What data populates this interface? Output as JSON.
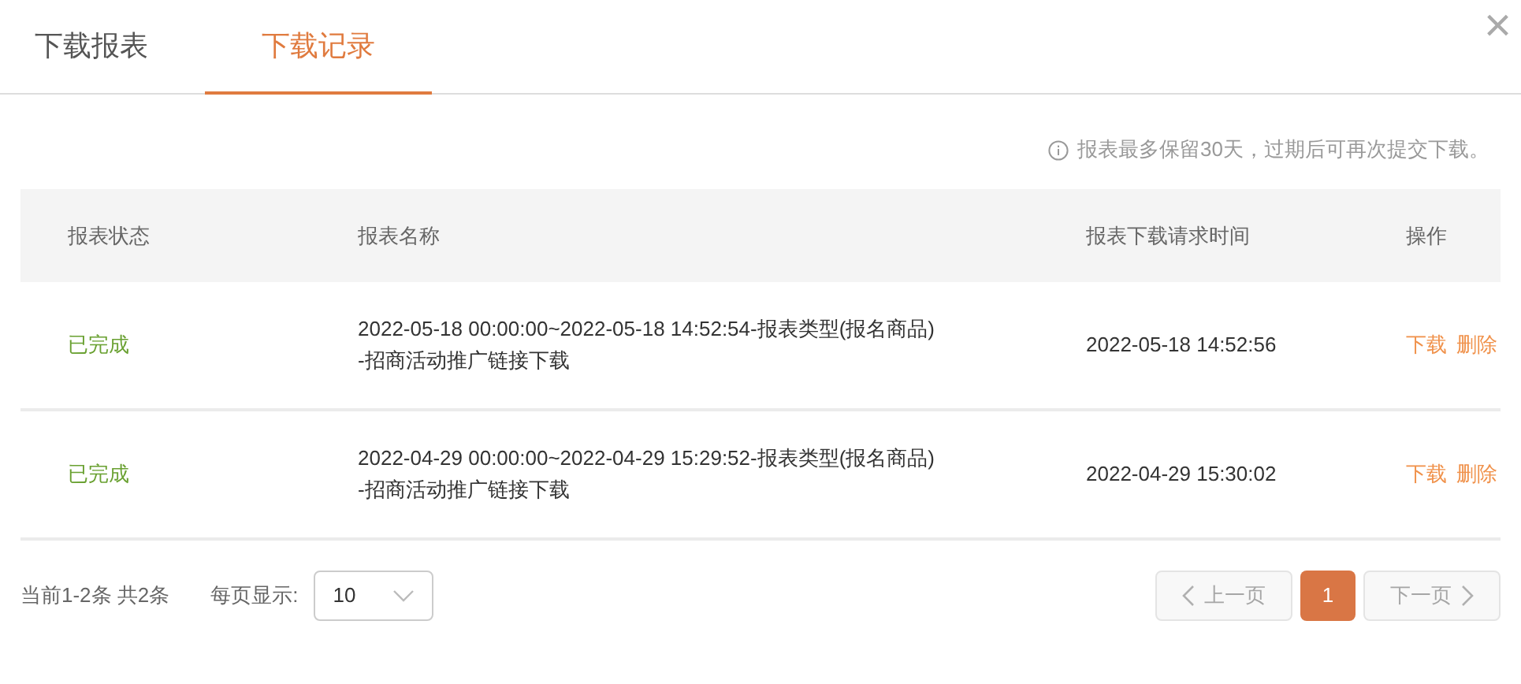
{
  "tabs": [
    {
      "label": "下载报表",
      "selected": false
    },
    {
      "label": "下载记录",
      "selected": true
    }
  ],
  "close": "×",
  "notice": "报表最多保留30天，过期后可再次提交下载。",
  "table": {
    "columns": [
      "报表状态",
      "报表名称",
      "报表下载请求时间",
      "操作"
    ],
    "rows": [
      {
        "status": "已完成",
        "name": [
          "2022-05-18 00:00:00~2022-05-18 14:52:54-报表类型(报名商品)",
          "-招商活动推广链接下载"
        ],
        "time": "2022-05-18 14:52:56",
        "actions": [
          "下载",
          "删除"
        ]
      },
      {
        "status": "已完成",
        "name": [
          "2022-04-29 00:00:00~2022-04-29 15:29:52-报表类型(报名商品)",
          "-招商活动推广链接下载"
        ],
        "time": "2022-04-29 15:30:02",
        "actions": [
          "下载",
          "删除"
        ]
      }
    ]
  },
  "footer": {
    "range": "当前1-2条 共2条",
    "page_size_label": "每页显示:",
    "page_size": "10",
    "pager": [
      {
        "kind": "prev",
        "label": "上一页",
        "disabled": true
      },
      {
        "kind": "page",
        "label": "1",
        "selected": true
      },
      {
        "kind": "next",
        "label": "下一页",
        "disabled": true
      }
    ]
  }
}
